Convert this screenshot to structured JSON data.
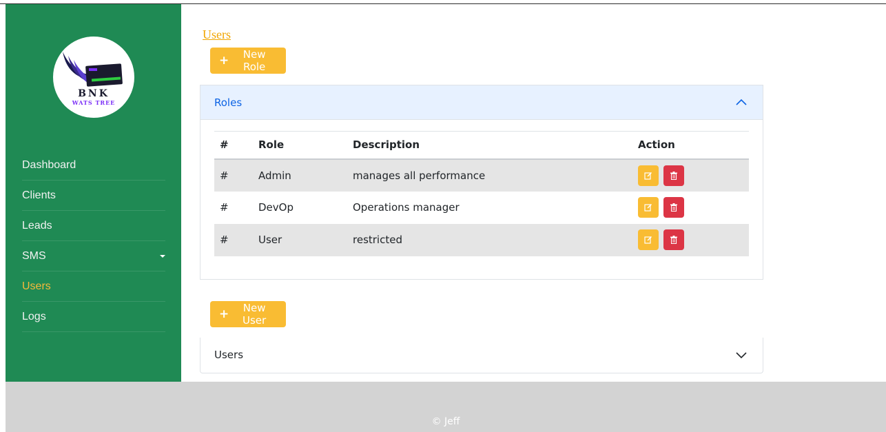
{
  "sidebar": {
    "logo": {
      "line1": "BNK",
      "line2": "WATS TREE"
    },
    "items": [
      {
        "label": "Dashboard",
        "active": false
      },
      {
        "label": "Clients",
        "active": false
      },
      {
        "label": "Leads",
        "active": false
      },
      {
        "label": "SMS",
        "active": false,
        "has_caret": true
      },
      {
        "label": "Users",
        "active": true
      },
      {
        "label": "Logs",
        "active": false
      }
    ]
  },
  "breadcrumb": {
    "label": "Users"
  },
  "roles_section": {
    "new_button": {
      "icon": "plus-icon",
      "label": "New Role"
    },
    "accordion": {
      "title": "Roles",
      "expanded": true,
      "table": {
        "headers": [
          "#",
          "Role",
          "Description",
          "Action"
        ],
        "rows": [
          {
            "num": "#",
            "role": "Admin",
            "description": "manages all performance"
          },
          {
            "num": "#",
            "role": "DevOp",
            "description": "Operations manager"
          },
          {
            "num": "#",
            "role": "User",
            "description": "restricted"
          }
        ]
      }
    }
  },
  "users_section": {
    "new_button": {
      "icon": "plus-icon",
      "label": "New User"
    },
    "accordion": {
      "title": "Users",
      "expanded": false
    }
  },
  "footer": {
    "text": "© Jeff"
  },
  "colors": {
    "sidebar": "#1f8a54",
    "accent": "#f9bc33",
    "danger": "#dc3545",
    "link": "#f0a500",
    "accordion_active": "#0c63e4"
  }
}
